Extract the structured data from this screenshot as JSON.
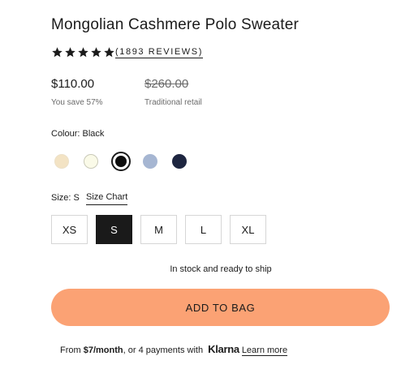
{
  "product": {
    "title": "Mongolian Cashmere Polo Sweater",
    "rating_stars": 5,
    "reviews_label": "(1893 REVIEWS)"
  },
  "pricing": {
    "price": "$110.00",
    "save": "You save 57%",
    "original_price": "$260.00",
    "original_label": "Traditional retail"
  },
  "colour": {
    "label": "Colour: Black",
    "swatches": [
      {
        "name": "cream",
        "hex": "#f3e3c4"
      },
      {
        "name": "ivory",
        "hex": "#fafae8"
      },
      {
        "name": "black",
        "hex": "#0d0d0d",
        "selected": true
      },
      {
        "name": "light-blue",
        "hex": "#a6b6d2"
      },
      {
        "name": "navy",
        "hex": "#1e2640"
      }
    ]
  },
  "size": {
    "label": "Size: S",
    "chart_link": "Size Chart",
    "options": [
      "XS",
      "S",
      "M",
      "L",
      "XL"
    ],
    "selected": "S"
  },
  "stock_text": "In stock and ready to ship",
  "add_to_bag": "ADD TO BAG",
  "financing": {
    "prefix": "From ",
    "amount": "$7/month",
    "middle": ", or 4 payments with ",
    "provider": "Klarna",
    "link": "Learn more"
  }
}
